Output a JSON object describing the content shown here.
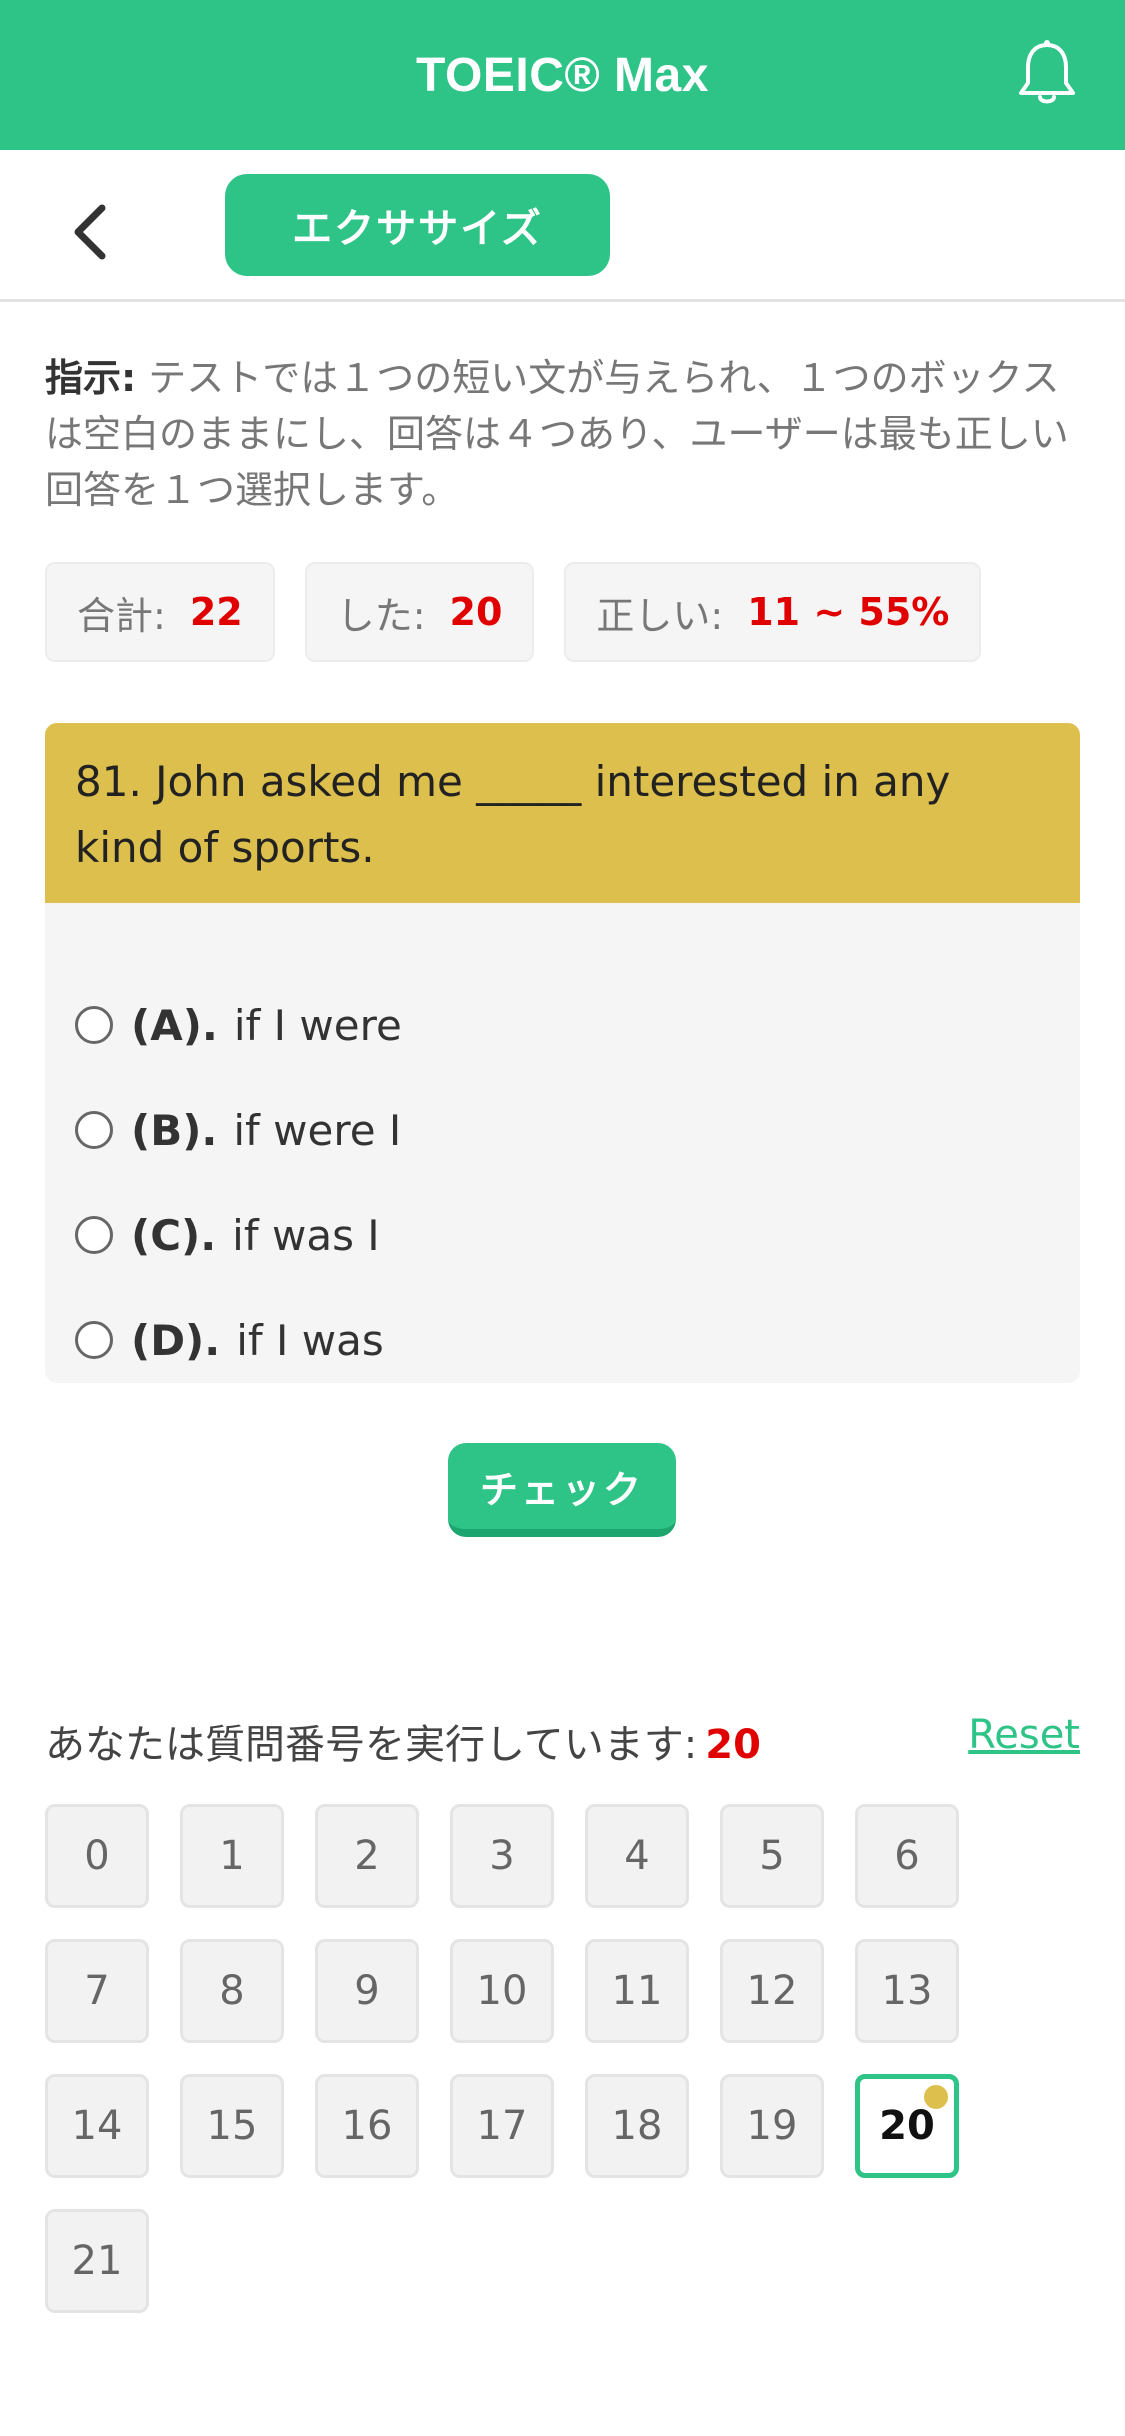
{
  "header": {
    "title": "TOEIC® Max",
    "icon": "bell-icon"
  },
  "subbar": {
    "back_icon": "chevron-left-icon",
    "section_label": "エクササイズ"
  },
  "instructions": {
    "label": "指示:",
    "text": "テストでは１つの短い文が与えられ、１つのボックスは空白のままにし、回答は４つあり、ユーザーは最も正しい回答を１つ選択します。"
  },
  "stats": {
    "total_label": "合計:",
    "total_value": "22",
    "done_label": "した:",
    "done_value": "20",
    "correct_label": "正しい:",
    "correct_value": "11 ~ 55%"
  },
  "question": {
    "text": "81. John asked me _____ interested in any kind of sports.",
    "options": [
      {
        "letter": "(A).",
        "text": "if I were"
      },
      {
        "letter": "(B).",
        "text": "if were I"
      },
      {
        "letter": "(C).",
        "text": "if was I"
      },
      {
        "letter": "(D).",
        "text": "if I was"
      }
    ]
  },
  "check_button": "チェック",
  "progress": {
    "label": "あなたは質問番号を実行しています:",
    "current": "20",
    "reset_label": "Reset"
  },
  "question_numbers": [
    "0",
    "1",
    "2",
    "3",
    "4",
    "5",
    "6",
    "7",
    "8",
    "9",
    "10",
    "11",
    "12",
    "13",
    "14",
    "15",
    "16",
    "17",
    "18",
    "19",
    "20",
    "21"
  ],
  "colors": {
    "primary": "#2ec387",
    "question_bg": "#dcbf4d",
    "highlight": "#e00000"
  }
}
